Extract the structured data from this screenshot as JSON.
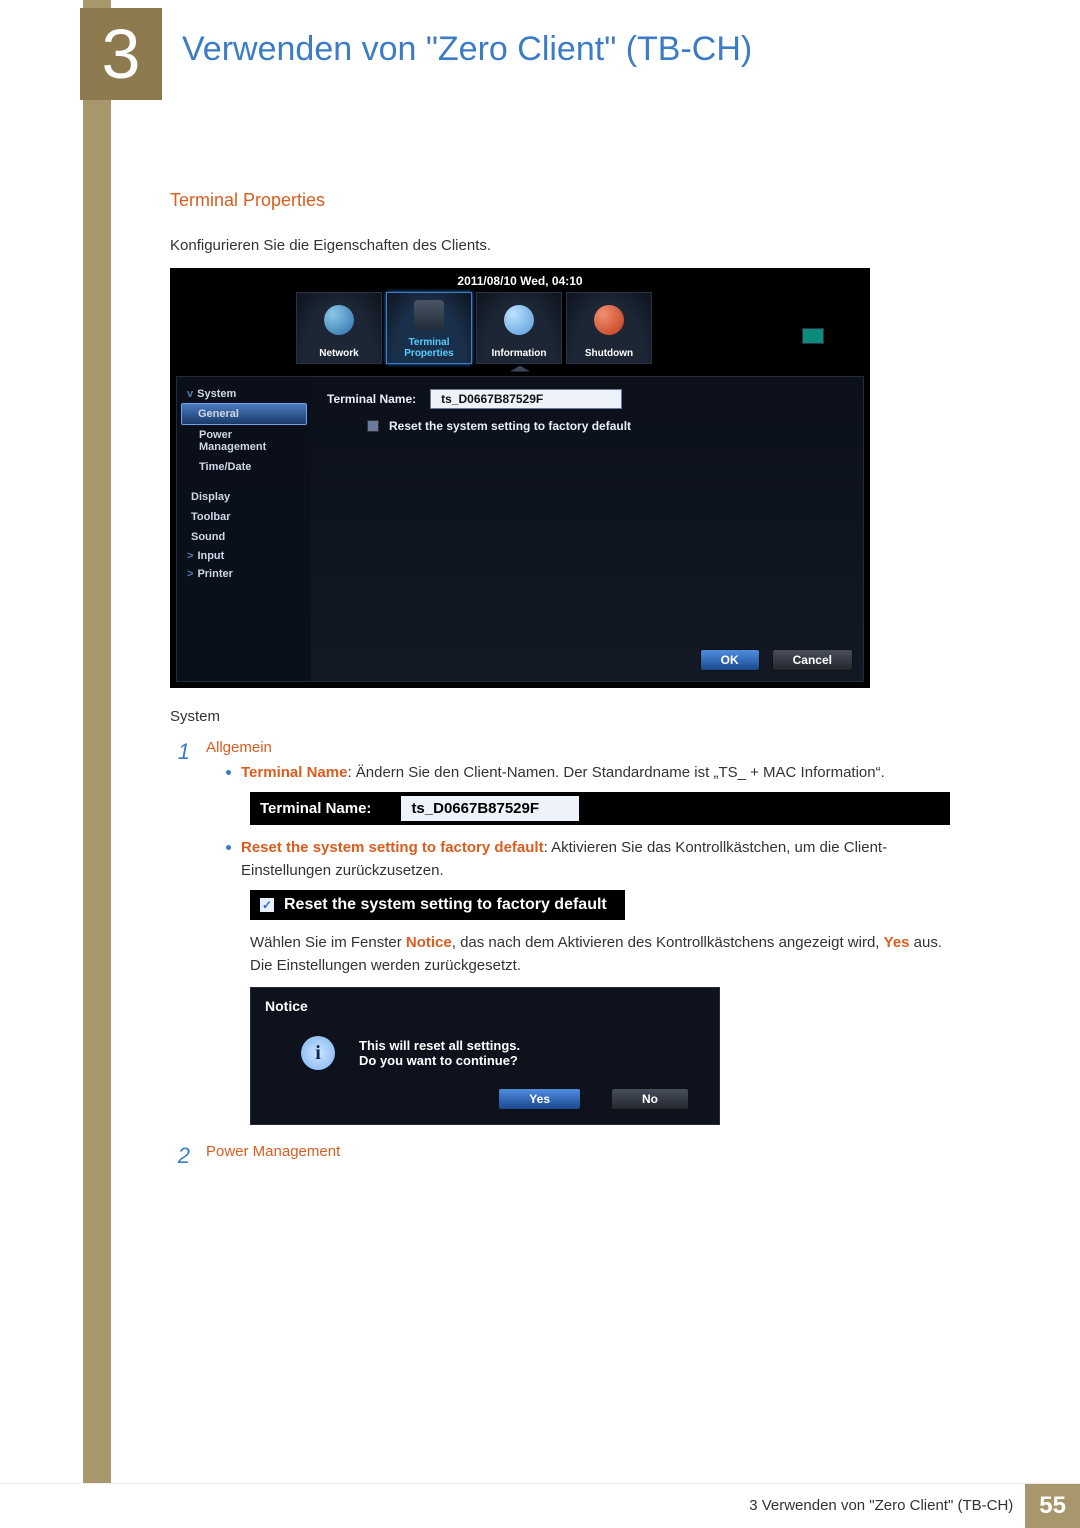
{
  "chapter_number": "3",
  "chapter_title": "Verwenden von \"Zero Client\" (TB-CH)",
  "section": "Terminal Properties",
  "intro": "Konfigurieren Sie die Eigenschaften des Clients.",
  "ss": {
    "datetime": "2011/08/10 Wed, 04:10",
    "tabs": {
      "network": "Network",
      "terminal": "Terminal Properties",
      "info": "Information",
      "shutdown": "Shutdown"
    },
    "side": {
      "system": "System",
      "general": "General",
      "power": "Power Management",
      "timedate": "Time/Date",
      "display": "Display",
      "toolbar": "Toolbar",
      "sound": "Sound",
      "input": "Input",
      "printer": "Printer"
    },
    "field_label": "Terminal Name:",
    "field_value": "ts_D0667B87529F",
    "reset_label": "Reset the system setting to factory default",
    "ok": "OK",
    "cancel": "Cancel"
  },
  "system_heading": "System",
  "item1": {
    "title": "Allgemein",
    "b1_bold": "Terminal Name",
    "b1_text": ": Ändern Sie den Client-Namen. Der Standardname ist „TS_ + MAC Information“.",
    "strip1_l": "Terminal Name:",
    "strip1_r": "ts_D0667B87529F",
    "b2_bold": "Reset the system setting to factory default",
    "b2_text": ": Aktivieren Sie das Kontrollkästchen, um die Client-Einstellungen zurückzusetzen.",
    "strip2": "Reset the system setting to factory default",
    "b3_pre": "Wählen Sie im Fenster ",
    "b3_notice": "Notice",
    "b3_mid": ", das nach dem Aktivieren des Kontrollkästchens angezeigt wird, ",
    "b3_yes": "Yes",
    "b3_post": " aus. Die Einstellungen werden zurückgesetzt."
  },
  "notice": {
    "title": "Notice",
    "line1": "This will reset all settings.",
    "line2": "Do you want to continue?",
    "yes": "Yes",
    "no": "No"
  },
  "item2_title": "Power Management",
  "footer": {
    "text": "3 Verwenden von \"Zero Client\" (TB-CH)",
    "page": "55"
  }
}
